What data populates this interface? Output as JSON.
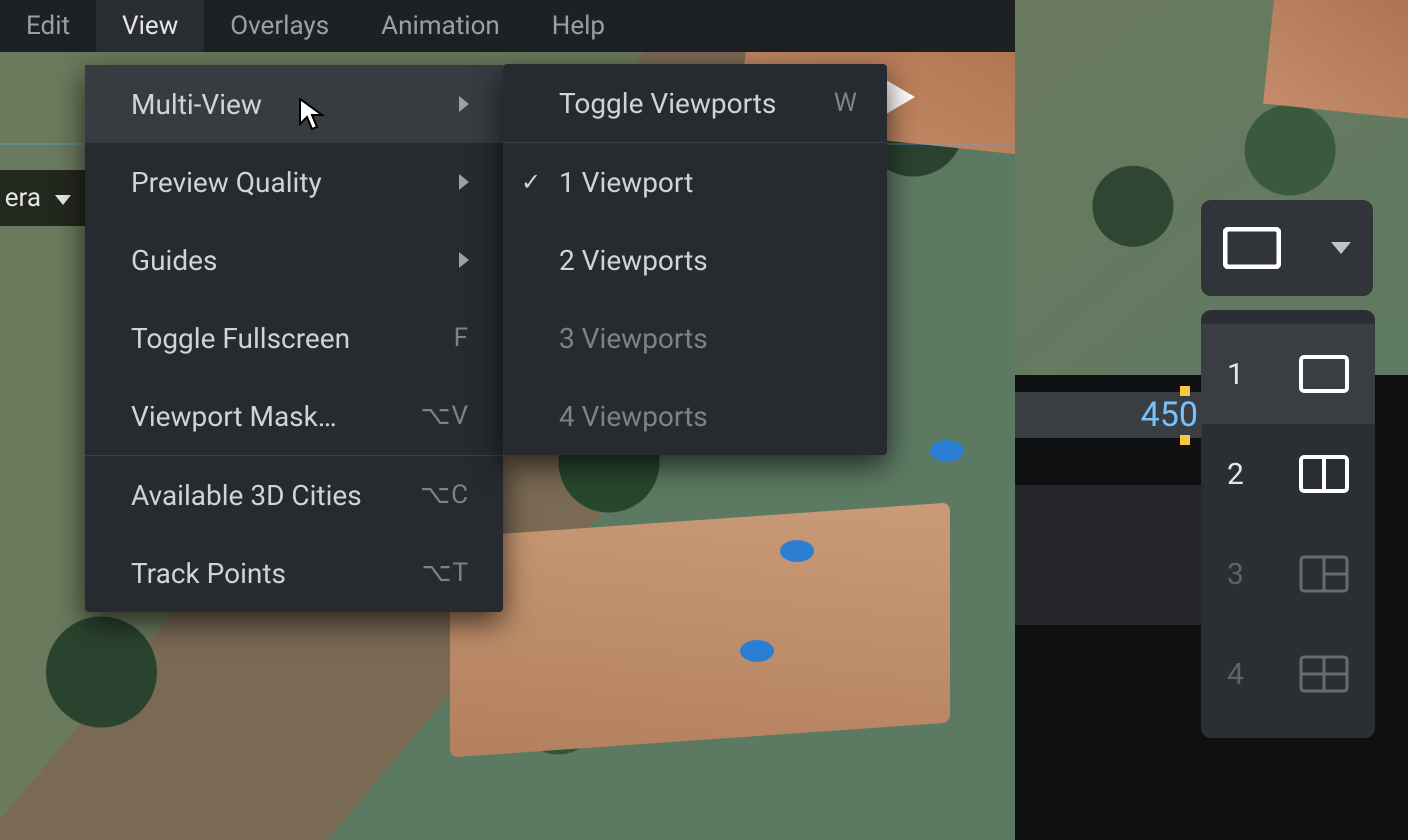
{
  "menubar": {
    "items": [
      "Edit",
      "View",
      "Overlays",
      "Animation",
      "Help"
    ],
    "active_index": 1
  },
  "camera_dropdown": {
    "label_fragment": "era"
  },
  "view_menu": {
    "items": [
      {
        "label": "Multi-View",
        "has_submenu": true,
        "highlight": true
      },
      {
        "label": "Preview Quality",
        "has_submenu": true
      },
      {
        "label": "Guides",
        "has_submenu": true
      },
      {
        "label": "Toggle Fullscreen",
        "shortcut_text": "F"
      },
      {
        "label": "Viewport Mask…",
        "shortcut_text": "⌥V"
      },
      {
        "label": "Available 3D Cities",
        "shortcut_text": "⌥C"
      },
      {
        "label": "Track Points",
        "shortcut_text": "⌥T"
      }
    ],
    "separator_after_index": 4
  },
  "multiview_submenu": {
    "header": {
      "label": "Toggle Viewports",
      "shortcut": "W"
    },
    "options": [
      {
        "label": "1 Viewport",
        "checked": true,
        "enabled": true
      },
      {
        "label": "2 Viewports",
        "checked": false,
        "enabled": true
      },
      {
        "label": "3 Viewports",
        "checked": false,
        "enabled": false
      },
      {
        "label": "4 Viewports",
        "checked": false,
        "enabled": false
      }
    ]
  },
  "viewport_selector": {
    "current_count": 1,
    "options": [
      {
        "n": "1",
        "enabled": true,
        "selected": true
      },
      {
        "n": "2",
        "enabled": true,
        "selected": false
      },
      {
        "n": "3",
        "enabled": false,
        "selected": false
      },
      {
        "n": "4",
        "enabled": false,
        "selected": false
      }
    ]
  },
  "numeric_field": {
    "value_visible": "450"
  },
  "colors": {
    "menu_bg": "#272a2e",
    "menu_highlight": "#383c41",
    "text": "#d0d3d7",
    "text_dim": "#7d828a",
    "value_blue": "#76c2ff",
    "handle_yellow": "#f5c83d"
  }
}
